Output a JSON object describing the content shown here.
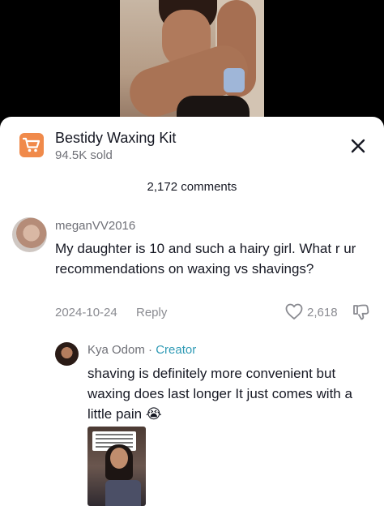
{
  "product": {
    "name": "Bestidy Waxing Kit",
    "sold": "94.5K sold",
    "cart_icon": "shopping-cart-icon",
    "close_icon": "close-icon"
  },
  "comments_header": "2,172 comments",
  "comment": {
    "username": "meganVV2016",
    "text": "My daughter is 10 and such a hairy girl. What r ur recommendations on waxing vs shavings?",
    "date": "2024-10-24",
    "reply_label": "Reply",
    "likes": "2,618"
  },
  "reply": {
    "username": "Kya Odom",
    "separator": "·",
    "role": "Creator",
    "text": "shaving is definitely more convenient but waxing does last longer It just comes with a little pain 😭"
  },
  "colors": {
    "accent_orange": "#f08a4b",
    "creator_blue": "#2f9ab5",
    "text": "#161823",
    "muted": "#8a8b91"
  }
}
